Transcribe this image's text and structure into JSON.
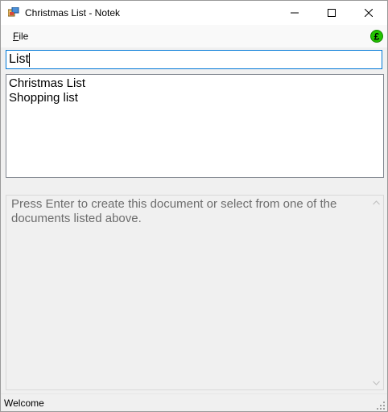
{
  "window": {
    "title": "Christmas List - Notek"
  },
  "titlebar": {
    "minimize_icon": "minimize-icon",
    "maximize_icon": "maximize-icon",
    "close_icon": "close-icon"
  },
  "menubar": {
    "file_hotkey": "F",
    "file_rest": "ile",
    "pound_icon": "pound-sign-icon"
  },
  "search": {
    "value": "List"
  },
  "documents": [
    "Christmas List",
    "Shopping list"
  ],
  "editor": {
    "text": "Press Enter to create this document or select from one of the documents listed above."
  },
  "statusbar": {
    "text": "Welcome"
  },
  "colors": {
    "accent": "#0078d7",
    "pound_icon": "#22c300"
  }
}
